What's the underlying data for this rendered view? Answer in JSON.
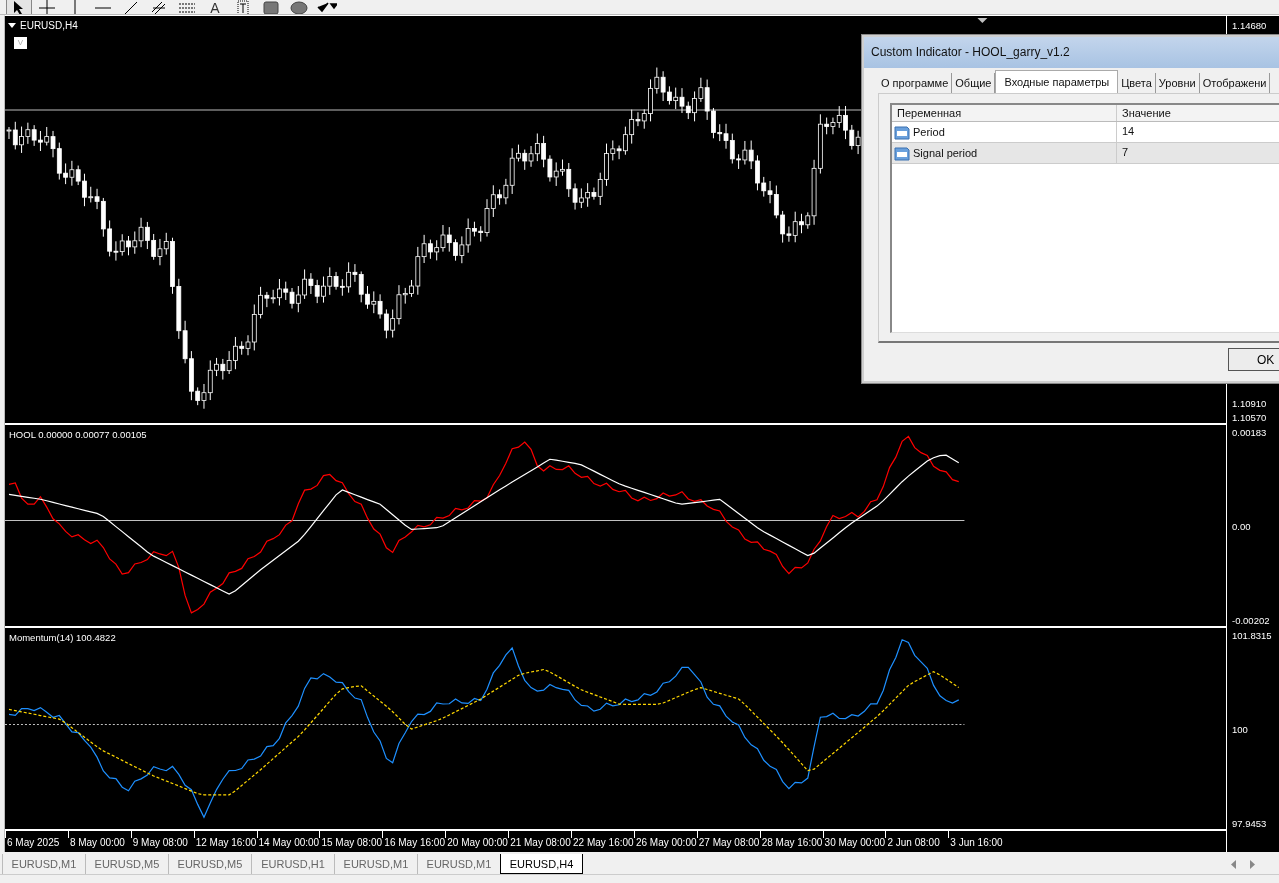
{
  "toolbar": {
    "tools": [
      {
        "kind": "cursor",
        "selected": true
      },
      {
        "kind": "crosshair",
        "selected": false
      },
      {
        "kind": "vline",
        "selected": false
      },
      {
        "kind": "hline",
        "selected": false
      },
      {
        "kind": "trendline",
        "selected": false
      },
      {
        "kind": "channel",
        "selected": false
      },
      {
        "kind": "fibo",
        "selected": false
      },
      {
        "kind": "text",
        "glyph": "A",
        "selected": false
      },
      {
        "kind": "label",
        "selected": false
      },
      {
        "kind": "rectangle",
        "selected": false
      },
      {
        "kind": "ellipse",
        "selected": false
      },
      {
        "kind": "arrows",
        "selected": false
      }
    ]
  },
  "chart": {
    "symbol": "EURUSD,H4",
    "v_button": "V",
    "main_axis": [
      "1.14680",
      "1.10910",
      "1.10570"
    ],
    "panes": [
      {
        "kind": "hool",
        "title": "HOOL 0.00000 0.00077 0.00105",
        "axis": [
          "0.00183",
          "0.00",
          "-0.00202"
        ]
      },
      {
        "kind": "momentum",
        "title": "Momentum(14) 100.4822",
        "axis": [
          "101.8315",
          "100",
          "97.9453"
        ]
      }
    ],
    "dates": [
      "6 May 2025",
      "8 May 00:00",
      "9 May 08:00",
      "12 May 16:00",
      "14 May 00:00",
      "15 May 08:00",
      "16 May 16:00",
      "20 May 00:00",
      "21 May 08:00",
      "22 May 16:00",
      "26 May 00:00",
      "27 May 08:00",
      "28 May 16:00",
      "30 May 00:00",
      "2 Jun 08:00",
      "3 Jun 16:00"
    ]
  },
  "dialog": {
    "title": "Custom Indicator - HOOL_garry_v1.2",
    "tabs": [
      {
        "label": "О программе",
        "selected": false
      },
      {
        "label": "Общие",
        "selected": false
      },
      {
        "label": "Входные параметры",
        "selected": true
      },
      {
        "label": "Цвета",
        "selected": false
      },
      {
        "label": "Уровни",
        "selected": false
      },
      {
        "label": "Отображени",
        "selected": false
      }
    ],
    "columns": [
      "Переменная",
      "Значение"
    ],
    "rows": [
      {
        "name": "Period",
        "value": "14",
        "selected": false
      },
      {
        "name": "Signal period",
        "value": "7",
        "selected": true
      }
    ],
    "ok_button": "OK"
  },
  "chart_tabs": [
    {
      "label": "EURUSD,M1",
      "selected": false
    },
    {
      "label": "EURUSD,M5",
      "selected": false
    },
    {
      "label": "EURUSD,M5",
      "selected": false
    },
    {
      "label": "EURUSD,H1",
      "selected": false
    },
    {
      "label": "EURUSD,M1",
      "selected": false
    },
    {
      "label": "EURUSD,M1",
      "selected": false
    },
    {
      "label": "EURUSD,H4",
      "selected": true
    }
  ]
}
